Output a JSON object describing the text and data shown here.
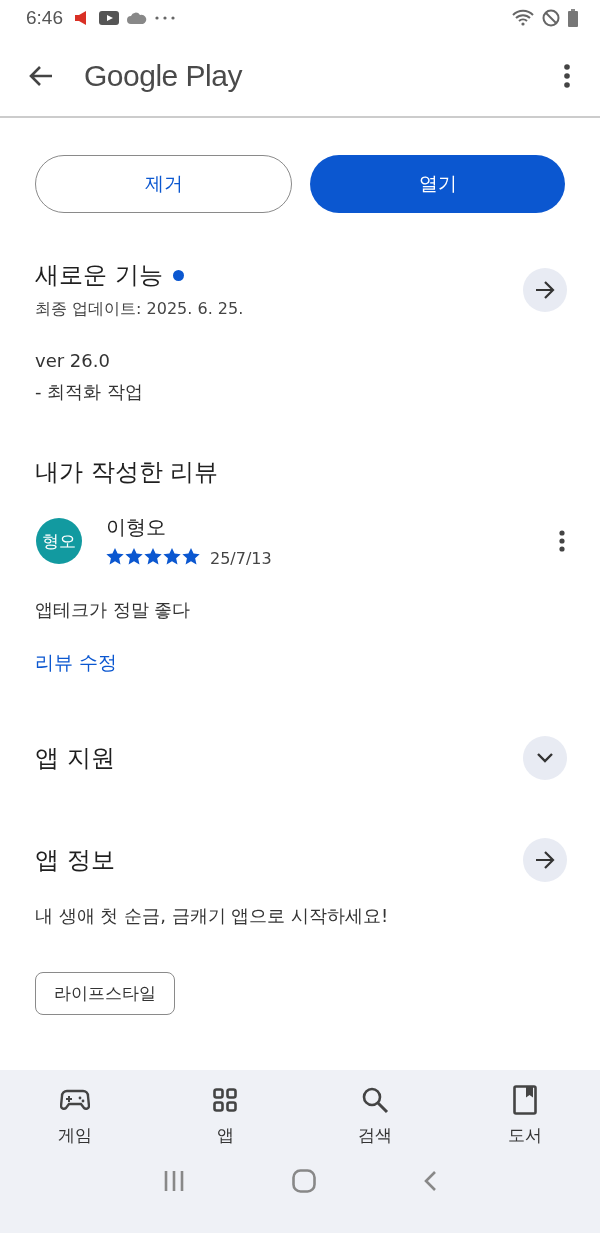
{
  "status_bar": {
    "time": "6:46"
  },
  "app_bar": {
    "title": "Google Play"
  },
  "actions": [
    {
      "label": "제거",
      "kind": "outlined"
    },
    {
      "label": "열기",
      "kind": "filled"
    }
  ],
  "whats_new": {
    "title": "새로운 기능",
    "new_dot": true,
    "updated": "최종 업데이트: 2025. 6. 25.",
    "notes": [
      "ver 26.0",
      "- 최적화 작업"
    ]
  },
  "my_review": {
    "title": "내가 작성한 리뷰",
    "avatar_text": "형오",
    "author": "이형오",
    "stars": 5,
    "date": "25/7/13",
    "text": "앱테크가 정말 좋다",
    "edit_link": "리뷰 수정"
  },
  "app_support": {
    "title": "앱 지원",
    "expanded": false
  },
  "app_info": {
    "title": "앱 정보",
    "description": "내 생애 첫 순금, 금캐기 앱으로 시작하세요!",
    "chip": "라이프스타일"
  },
  "bottom_nav": [
    {
      "label": "게임",
      "kind": "games",
      "selected": false
    },
    {
      "label": "앱",
      "kind": "apps",
      "selected": false
    },
    {
      "label": "검색",
      "kind": "search",
      "selected": false
    },
    {
      "label": "도서",
      "kind": "books",
      "selected": false
    }
  ]
}
